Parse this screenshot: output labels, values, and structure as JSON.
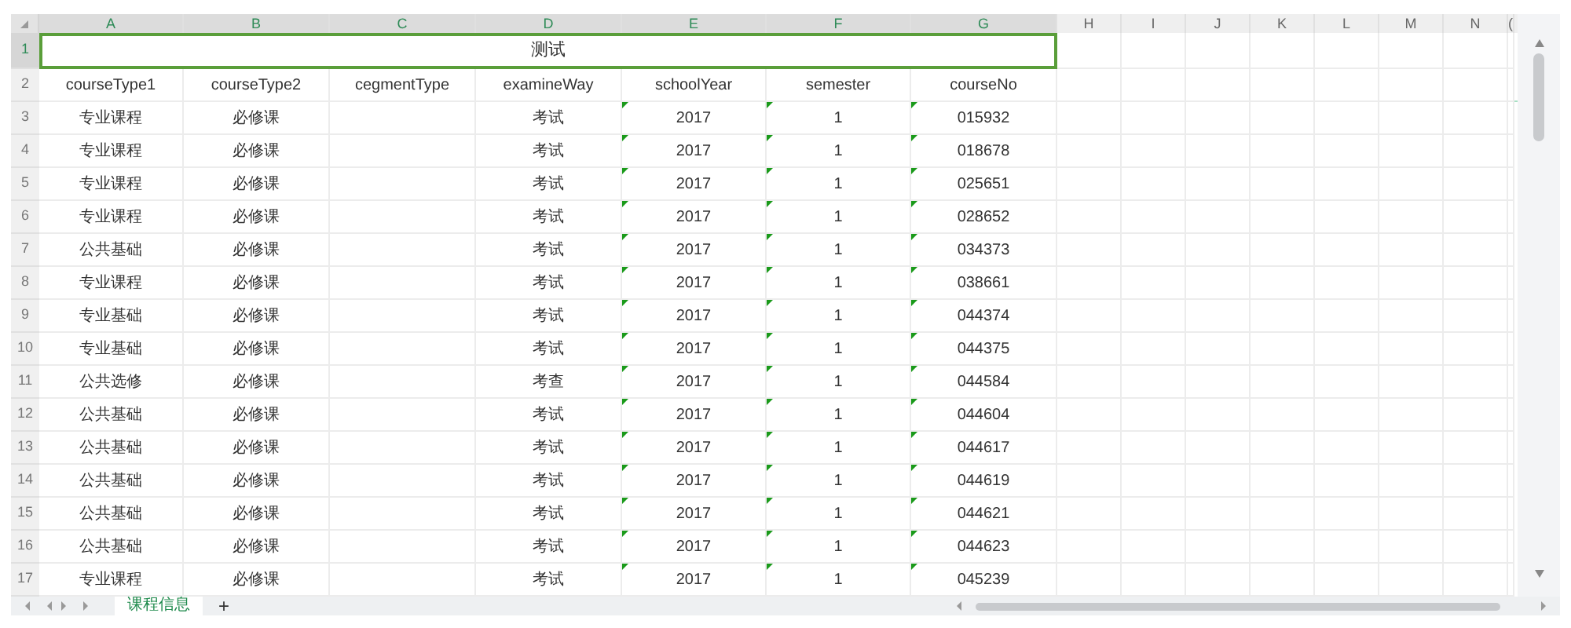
{
  "columns": [
    {
      "letter": "A",
      "selected": true,
      "text_flag": false
    },
    {
      "letter": "B",
      "selected": true,
      "text_flag": false
    },
    {
      "letter": "C",
      "selected": true,
      "text_flag": false
    },
    {
      "letter": "D",
      "selected": true,
      "text_flag": false
    },
    {
      "letter": "E",
      "selected": true,
      "text_flag": true
    },
    {
      "letter": "F",
      "selected": true,
      "text_flag": true
    },
    {
      "letter": "G",
      "selected": true,
      "text_flag": true
    },
    {
      "letter": "H",
      "selected": false,
      "text_flag": false
    },
    {
      "letter": "I",
      "selected": false,
      "text_flag": false
    },
    {
      "letter": "J",
      "selected": false,
      "text_flag": false
    },
    {
      "letter": "K",
      "selected": false,
      "text_flag": false
    },
    {
      "letter": "L",
      "selected": false,
      "text_flag": false
    },
    {
      "letter": "M",
      "selected": false,
      "text_flag": false
    },
    {
      "letter": "N",
      "selected": false,
      "text_flag": false
    },
    {
      "letter": "(",
      "selected": false,
      "text_flag": false
    }
  ],
  "title_row": {
    "number": "1",
    "selected": true,
    "text": "测试"
  },
  "header_row": {
    "number": "2",
    "selected": false,
    "cells": [
      "courseType1",
      "courseType2",
      "cegmentType",
      "examineWay",
      "schoolYear",
      "semester",
      "courseNo"
    ]
  },
  "rows": [
    {
      "number": "3",
      "selected": false,
      "cells": [
        "专业课程",
        "必修课",
        "",
        "考试",
        "2017",
        "1",
        "015932"
      ]
    },
    {
      "number": "4",
      "selected": false,
      "cells": [
        "专业课程",
        "必修课",
        "",
        "考试",
        "2017",
        "1",
        "018678"
      ]
    },
    {
      "number": "5",
      "selected": false,
      "cells": [
        "专业课程",
        "必修课",
        "",
        "考试",
        "2017",
        "1",
        "025651"
      ]
    },
    {
      "number": "6",
      "selected": false,
      "cells": [
        "专业课程",
        "必修课",
        "",
        "考试",
        "2017",
        "1",
        "028652"
      ]
    },
    {
      "number": "7",
      "selected": false,
      "cells": [
        "公共基础",
        "必修课",
        "",
        "考试",
        "2017",
        "1",
        "034373"
      ]
    },
    {
      "number": "8",
      "selected": false,
      "cells": [
        "专业课程",
        "必修课",
        "",
        "考试",
        "2017",
        "1",
        "038661"
      ]
    },
    {
      "number": "9",
      "selected": false,
      "cells": [
        "专业基础",
        "必修课",
        "",
        "考试",
        "2017",
        "1",
        "044374"
      ]
    },
    {
      "number": "10",
      "selected": false,
      "cells": [
        "专业基础",
        "必修课",
        "",
        "考试",
        "2017",
        "1",
        "044375"
      ]
    },
    {
      "number": "11",
      "selected": false,
      "cells": [
        "公共选修",
        "必修课",
        "",
        "考查",
        "2017",
        "1",
        "044584"
      ]
    },
    {
      "number": "12",
      "selected": false,
      "cells": [
        "公共基础",
        "必修课",
        "",
        "考试",
        "2017",
        "1",
        "044604"
      ]
    },
    {
      "number": "13",
      "selected": false,
      "cells": [
        "公共基础",
        "必修课",
        "",
        "考试",
        "2017",
        "1",
        "044617"
      ]
    },
    {
      "number": "14",
      "selected": false,
      "cells": [
        "公共基础",
        "必修课",
        "",
        "考试",
        "2017",
        "1",
        "044619"
      ]
    },
    {
      "number": "15",
      "selected": false,
      "cells": [
        "公共基础",
        "必修课",
        "",
        "考试",
        "2017",
        "1",
        "044621"
      ]
    },
    {
      "number": "16",
      "selected": false,
      "cells": [
        "公共基础",
        "必修课",
        "",
        "考试",
        "2017",
        "1",
        "044623"
      ]
    },
    {
      "number": "17",
      "selected": false,
      "cells": [
        "专业课程",
        "必修课",
        "",
        "考试",
        "2017",
        "1",
        "045239"
      ]
    }
  ],
  "sheet_tabs": [
    {
      "label": "课程信息",
      "selected": true
    }
  ],
  "add_sheet": "+"
}
